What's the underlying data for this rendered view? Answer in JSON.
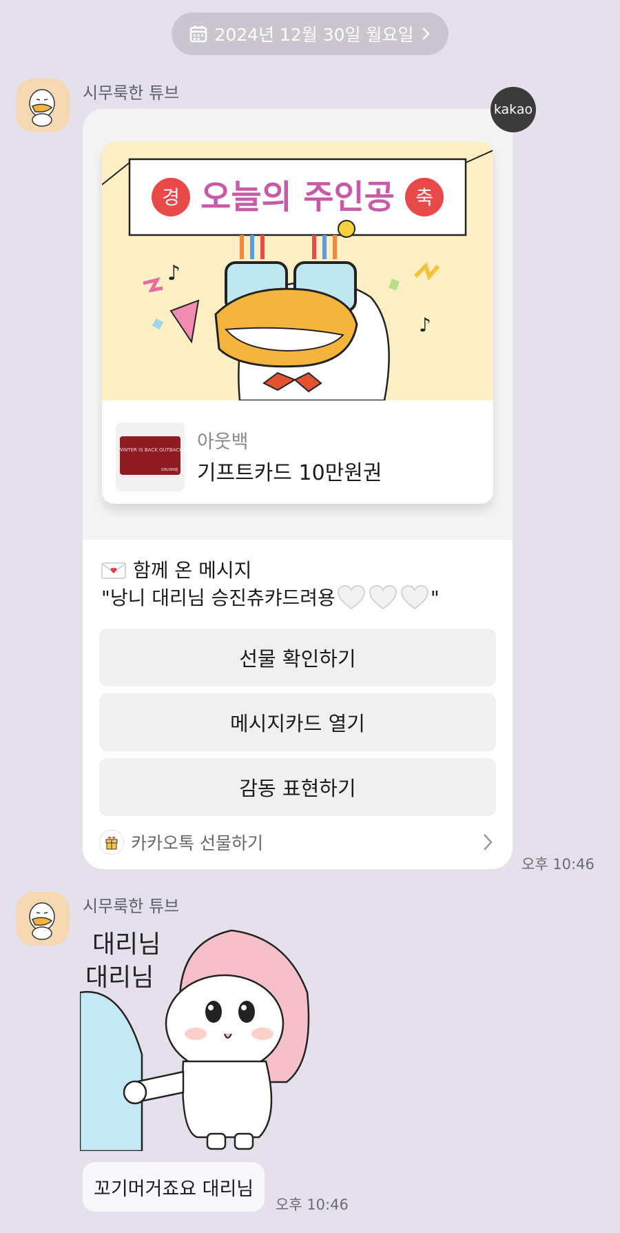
{
  "date_header": {
    "label": "2024년 12월 30일 월요일",
    "calendar_icon": "calendar-icon",
    "chevron_icon": "chevron-right-icon"
  },
  "messages": [
    {
      "sender": "시무룩한 튜브",
      "gift_card": {
        "banner_text": "오늘의 주인공",
        "banner_left_badge": "경",
        "banner_right_badge": "축",
        "thumbnail_text": "WINTER IS BACK OUTBACK",
        "thumbnail_price": "100,000원",
        "brand": "아웃백",
        "product": "기프트카드 10만원권",
        "message_title": "함께 온 메시지",
        "message_text_prefix": "\"낭니 대리님 승진츄캬드려용",
        "message_text_suffix": "\"",
        "buttons": [
          "선물 확인하기",
          "메시지카드 열기",
          "감동 표현하기"
        ],
        "footer_label": "카카오톡 선물하기"
      },
      "badge": "kakao",
      "time": "오후 10:46"
    },
    {
      "sender": "시무룩한 튜브",
      "sticker_text_line1": "대리님",
      "sticker_text_line2": "대리님",
      "bubble_text": "꼬기머거죠요 대리님",
      "time": "오후 10:46"
    }
  ],
  "colors": {
    "background": "#e4e1ec",
    "date_pill": "#c9c6cf",
    "button": "#f0f0f0",
    "bubble": "#f8f7fa"
  }
}
